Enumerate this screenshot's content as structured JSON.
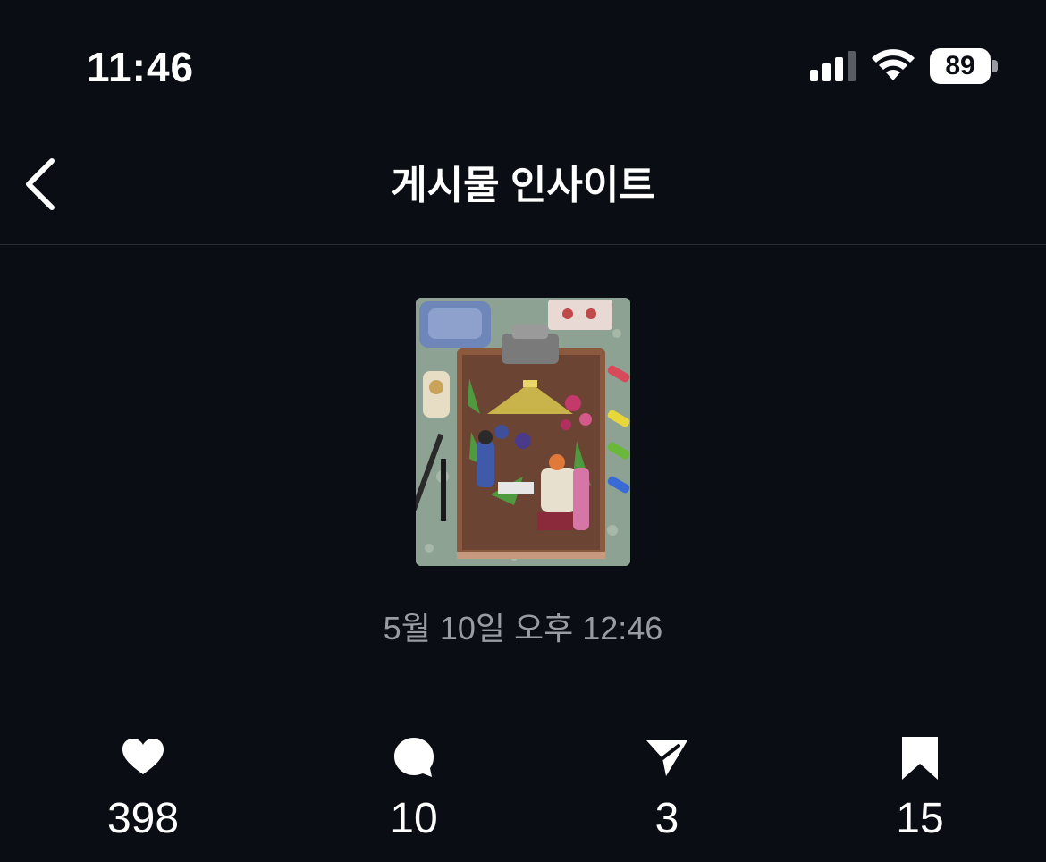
{
  "status_bar": {
    "time": "11:46",
    "battery_level": "89",
    "icons": [
      "cellular-signal-icon",
      "wifi-icon",
      "battery-icon"
    ]
  },
  "header": {
    "back_icon": "chevron-left-icon",
    "title": "게시물 인사이트"
  },
  "post": {
    "thumbnail": "post-image",
    "date": "5월 10일 오후 12:46"
  },
  "metrics": [
    {
      "icon": "heart-icon",
      "value": "398"
    },
    {
      "icon": "comment-icon",
      "value": "10"
    },
    {
      "icon": "send-icon",
      "value": "3"
    },
    {
      "icon": "bookmark-icon",
      "value": "15"
    }
  ],
  "colors": {
    "background": "#0b0d14",
    "text": "#ffffff",
    "secondary_text": "#9a9ca3",
    "divider": "#2a2d35"
  }
}
